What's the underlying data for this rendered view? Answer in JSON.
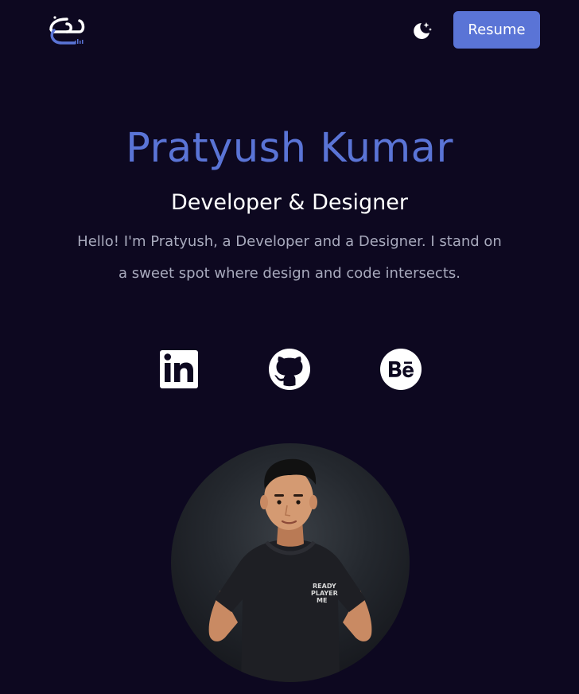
{
  "header": {
    "logo_icon": "brand-logo-icon",
    "theme_icon": "moon-stars-icon",
    "resume_label": "Resume"
  },
  "hero": {
    "name": "Pratyush Kumar",
    "role": "Developer & Designer",
    "intro": "Hello! I'm Pratyush, a Developer and a Designer. I stand on a sweet spot where design and code intersects."
  },
  "social": [
    {
      "icon": "linkedin-icon"
    },
    {
      "icon": "github-icon"
    },
    {
      "icon": "behance-icon"
    }
  ],
  "avatar": {
    "tshirt_text": [
      "READY",
      "PLAYER",
      "ME"
    ]
  },
  "colors": {
    "background": "#0d0820",
    "accent": "#5a74d6",
    "text": "#ffffff",
    "muted_text": "#a8aabd"
  }
}
